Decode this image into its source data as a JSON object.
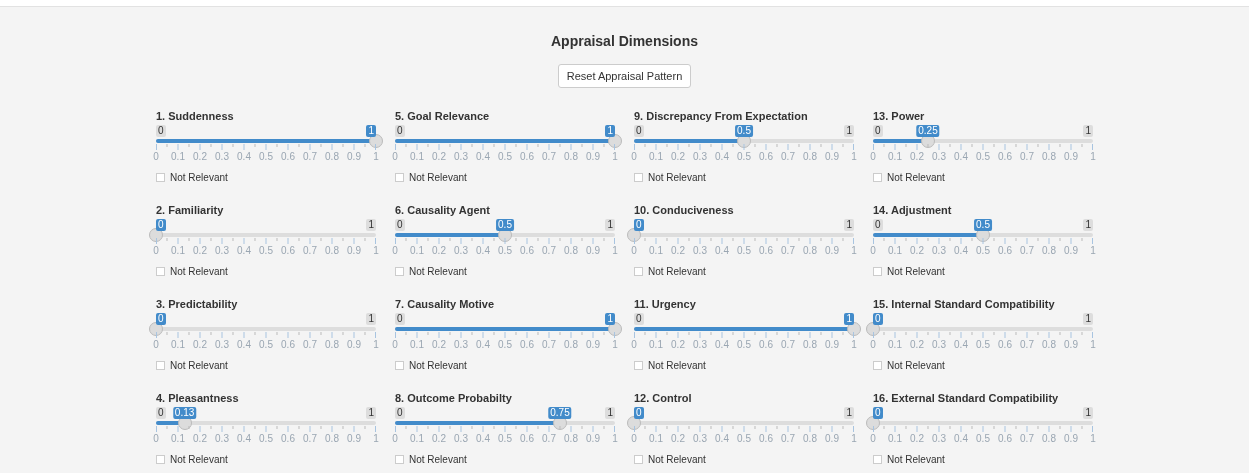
{
  "title": "Appraisal Dimensions",
  "reset_button": "Reset Appraisal Pattern",
  "sliders": [
    {
      "label": "1. Suddenness",
      "min": "0",
      "value": "1",
      "level": 1,
      "ticks": [
        "0",
        "0.1",
        "0.2",
        "0.3",
        "0.4",
        "0.5",
        "0.6",
        "0.7",
        "0.8",
        "0.9",
        "1"
      ],
      "not_relevant": {
        "label": "Not Relevant",
        "checked": false
      }
    },
    {
      "label": "2. Familiarity",
      "value": "0",
      "max": "1",
      "level": 0,
      "ticks": [
        "0",
        "0.1",
        "0.2",
        "0.3",
        "0.4",
        "0.5",
        "0.6",
        "0.7",
        "0.8",
        "0.9",
        "1"
      ],
      "not_relevant": {
        "label": "Not Relevant",
        "checked": false
      }
    },
    {
      "label": "3. Predictability",
      "value": "0",
      "max": "1",
      "level": 0,
      "ticks": [
        "0",
        "0.1",
        "0.2",
        "0.3",
        "0.4",
        "0.5",
        "0.6",
        "0.7",
        "0.8",
        "0.9",
        "1"
      ],
      "not_relevant": {
        "label": "Not Relevant",
        "checked": false
      }
    },
    {
      "label": "4. Pleasantness",
      "min": "0",
      "value": "0.13",
      "max": "1",
      "level": 0.13,
      "ticks": [
        "0",
        "0.1",
        "0.2",
        "0.3",
        "0.4",
        "0.5",
        "0.6",
        "0.7",
        "0.8",
        "0.9",
        "1"
      ],
      "not_relevant": {
        "label": "Not Relevant",
        "checked": false
      }
    },
    {
      "label": "5. Goal Relevance",
      "min": "0",
      "value": "1",
      "level": 1,
      "ticks": [
        "0",
        "0.1",
        "0.2",
        "0.3",
        "0.4",
        "0.5",
        "0.6",
        "0.7",
        "0.8",
        "0.9",
        "1"
      ],
      "not_relevant": {
        "label": "Not Relevant",
        "checked": false
      }
    },
    {
      "label": "6. Causality Agent",
      "min": "0",
      "value": "0.5",
      "max": "1",
      "level": 0.5,
      "ticks": [
        "0",
        "0.1",
        "0.2",
        "0.3",
        "0.4",
        "0.5",
        "0.6",
        "0.7",
        "0.8",
        "0.9",
        "1"
      ],
      "not_relevant": {
        "label": "Not Relevant",
        "checked": false
      }
    },
    {
      "label": "7. Causality Motive",
      "min": "0",
      "value": "1",
      "level": 1,
      "ticks": [
        "0",
        "0.1",
        "0.2",
        "0.3",
        "0.4",
        "0.5",
        "0.6",
        "0.7",
        "0.8",
        "0.9",
        "1"
      ],
      "not_relevant": {
        "label": "Not Relevant",
        "checked": false
      }
    },
    {
      "label": "8. Outcome Probabilty",
      "min": "0",
      "value": "0.75",
      "max": "1",
      "level": 0.75,
      "ticks": [
        "0",
        "0.1",
        "0.2",
        "0.3",
        "0.4",
        "0.5",
        "0.6",
        "0.7",
        "0.8",
        "0.9",
        "1"
      ],
      "not_relevant": {
        "label": "Not Relevant",
        "checked": false
      }
    },
    {
      "label": "9. Discrepancy From Expectation",
      "min": "0",
      "value": "0.5",
      "max": "1",
      "level": 0.5,
      "ticks": [
        "0",
        "0.1",
        "0.2",
        "0.3",
        "0.4",
        "0.5",
        "0.6",
        "0.7",
        "0.8",
        "0.9",
        "1"
      ],
      "not_relevant": {
        "label": "Not Relevant",
        "checked": false
      }
    },
    {
      "label": "10. Conduciveness",
      "value": "0",
      "max": "1",
      "level": 0,
      "ticks": [
        "0",
        "0.1",
        "0.2",
        "0.3",
        "0.4",
        "0.5",
        "0.6",
        "0.7",
        "0.8",
        "0.9",
        "1"
      ],
      "not_relevant": {
        "label": "Not Relevant",
        "checked": false
      }
    },
    {
      "label": "11. Urgency",
      "min": "0",
      "value": "1",
      "level": 1,
      "ticks": [
        "0",
        "0.1",
        "0.2",
        "0.3",
        "0.4",
        "0.5",
        "0.6",
        "0.7",
        "0.8",
        "0.9",
        "1"
      ],
      "not_relevant": {
        "label": "Not Relevant",
        "checked": false
      }
    },
    {
      "label": "12. Control",
      "value": "0",
      "max": "1",
      "level": 0,
      "ticks": [
        "0",
        "0.1",
        "0.2",
        "0.3",
        "0.4",
        "0.5",
        "0.6",
        "0.7",
        "0.8",
        "0.9",
        "1"
      ],
      "not_relevant": {
        "label": "Not Relevant",
        "checked": false
      }
    },
    {
      "label": "13. Power",
      "min": "0",
      "value": "0.25",
      "max": "1",
      "level": 0.25,
      "ticks": [
        "0",
        "0.1",
        "0.2",
        "0.3",
        "0.4",
        "0.5",
        "0.6",
        "0.7",
        "0.8",
        "0.9",
        "1"
      ],
      "not_relevant": {
        "label": "Not Relevant",
        "checked": false
      }
    },
    {
      "label": "14. Adjustment",
      "min": "0",
      "value": "0.5",
      "max": "1",
      "level": 0.5,
      "ticks": [
        "0",
        "0.1",
        "0.2",
        "0.3",
        "0.4",
        "0.5",
        "0.6",
        "0.7",
        "0.8",
        "0.9",
        "1"
      ],
      "not_relevant": {
        "label": "Not Relevant",
        "checked": false
      }
    },
    {
      "label": "15. Internal Standard Compatibility",
      "value": "0",
      "max": "1",
      "level": 0,
      "ticks": [
        "0",
        "0.1",
        "0.2",
        "0.3",
        "0.4",
        "0.5",
        "0.6",
        "0.7",
        "0.8",
        "0.9",
        "1"
      ],
      "not_relevant": {
        "label": "Not Relevant",
        "checked": false
      }
    },
    {
      "label": "16. External Standard Compatibility",
      "value": "0",
      "max": "1",
      "level": 0,
      "ticks": [
        "0",
        "0.1",
        "0.2",
        "0.3",
        "0.4",
        "0.5",
        "0.6",
        "0.7",
        "0.8",
        "0.9",
        "1"
      ],
      "not_relevant": {
        "label": "Not Relevant",
        "checked": false
      }
    }
  ]
}
